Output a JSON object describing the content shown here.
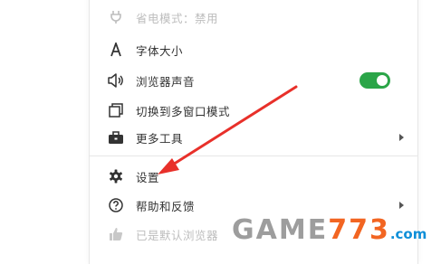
{
  "menu": {
    "items": [
      {
        "label": "省电模式：禁用",
        "icon": "plug-icon",
        "disabled": true
      },
      {
        "label": "字体大小",
        "icon": "font-size-icon"
      },
      {
        "label": "浏览器声音",
        "icon": "speaker-icon",
        "toggle_on": true
      },
      {
        "label": "切换到多窗口模式",
        "icon": "multi-window-icon"
      },
      {
        "label": "更多工具",
        "icon": "toolbox-icon",
        "has_submenu": true
      },
      {
        "label": "设置",
        "icon": "gear-icon"
      },
      {
        "label": "帮助和反馈",
        "icon": "help-icon",
        "has_submenu": true
      },
      {
        "label": "已是默认浏览器",
        "icon": "thumbs-up-icon",
        "disabled": true
      }
    ]
  },
  "watermark": {
    "part1": "GAME",
    "part2": "773",
    "part3": ".com"
  },
  "colors": {
    "toggle_on": "#2ba548",
    "annotation_arrow": "#e8302a"
  }
}
